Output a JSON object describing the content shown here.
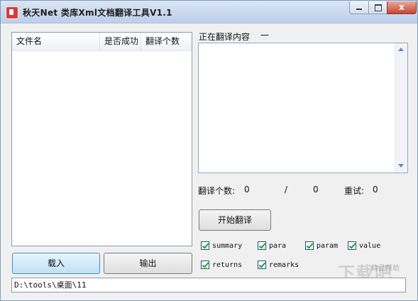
{
  "window": {
    "title": "秋天Net 类库Xml文档翻译工具V1.1",
    "close_glyph": "x"
  },
  "file_list": {
    "columns": [
      "文件名",
      "是否成功",
      "翻译个数"
    ],
    "rows": []
  },
  "translating": {
    "label": "正在翻译内容",
    "value": "一",
    "content": ""
  },
  "stats": {
    "count_label": "翻译个数:",
    "done": "0",
    "separator": "/",
    "total": "0",
    "retry_label": "重试:",
    "retry": "0"
  },
  "buttons": {
    "start": "开始翻译",
    "load": "载入",
    "export": "输出"
  },
  "options": [
    {
      "label": "summary",
      "checked": true
    },
    {
      "label": "para",
      "checked": true
    },
    {
      "label": "param",
      "checked": true
    },
    {
      "label": "value",
      "checked": true
    },
    {
      "label": "returns",
      "checked": true
    },
    {
      "label": "remarks",
      "checked": true
    }
  ],
  "status": {
    "path": "D:\\tools\\桌面\\11"
  },
  "watermark": {
    "text": "下载吧",
    "subtext": "精品帮助"
  },
  "colors": {
    "check": "#21a121",
    "title_bar": "#c9d8ee",
    "load_button": "#bfe1f6"
  }
}
